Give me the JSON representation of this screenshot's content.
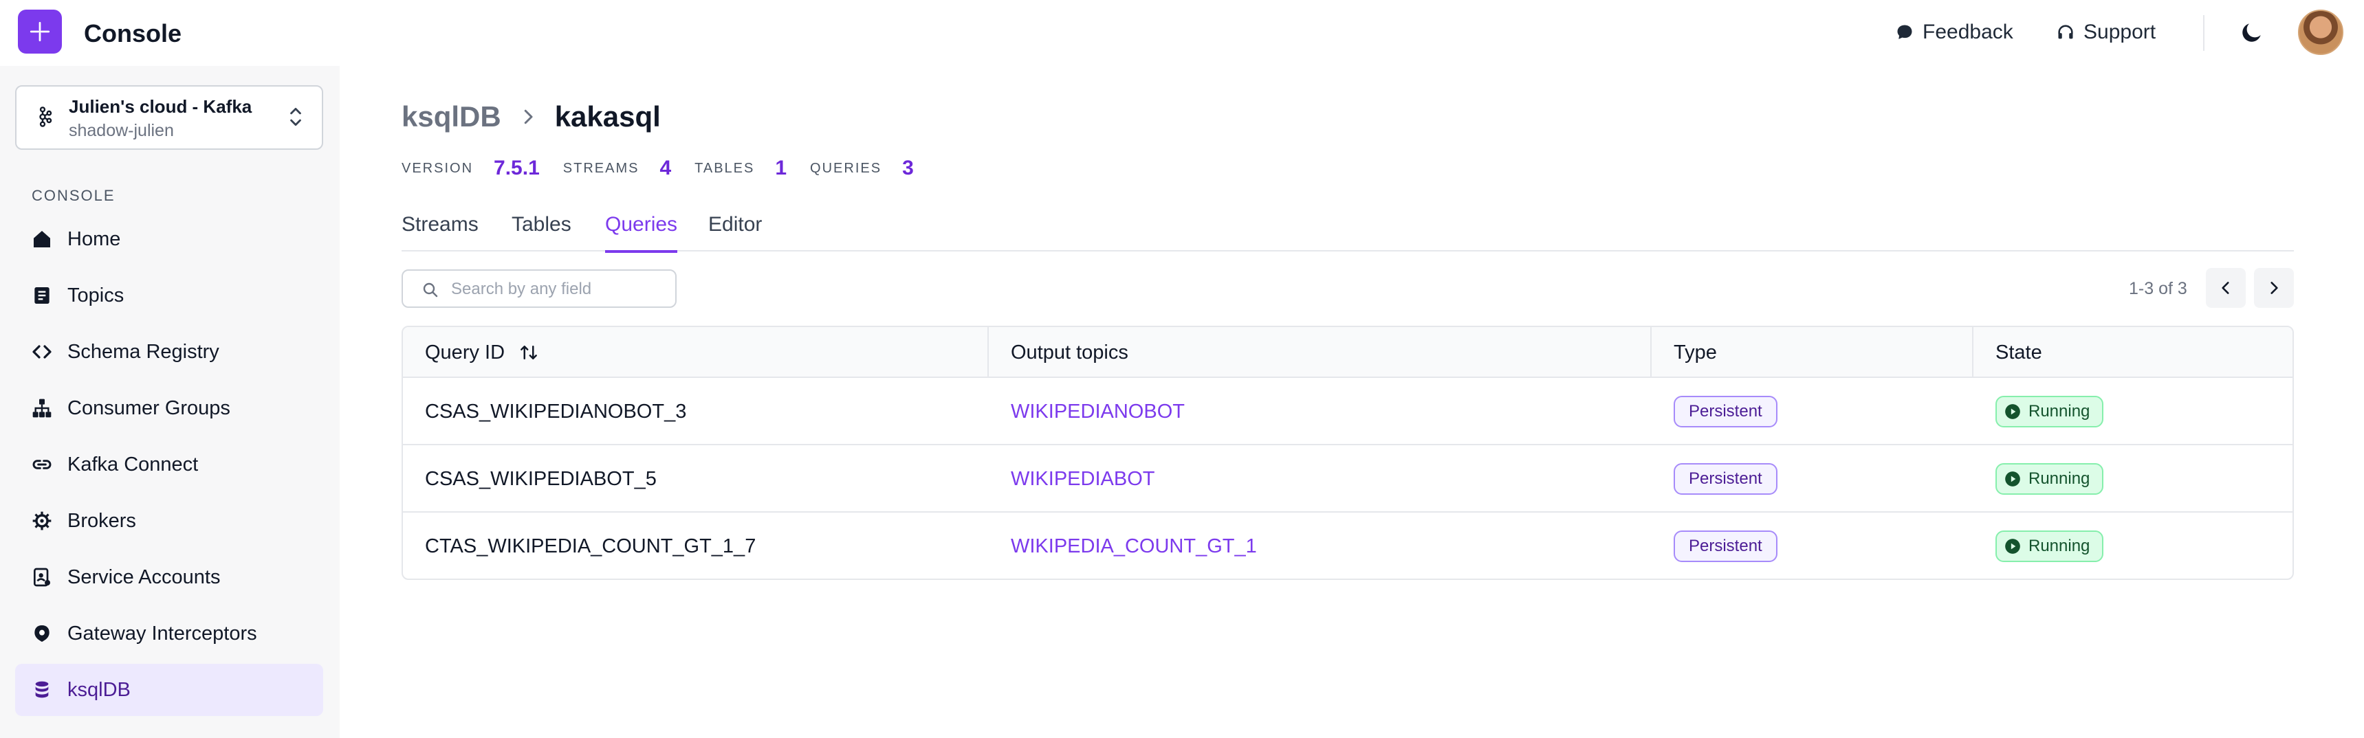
{
  "header": {
    "app_title": "Console",
    "feedback_label": "Feedback",
    "support_label": "Support"
  },
  "cluster": {
    "name": "Julien's cloud - Kafka",
    "subtitle": "shadow-julien"
  },
  "sidebar": {
    "section_label": "CONSOLE",
    "items": [
      {
        "label": "Home",
        "icon": "home-icon"
      },
      {
        "label": "Topics",
        "icon": "topics-icon"
      },
      {
        "label": "Schema Registry",
        "icon": "code-icon"
      },
      {
        "label": "Consumer Groups",
        "icon": "hierarchy-icon"
      },
      {
        "label": "Kafka Connect",
        "icon": "link-icon"
      },
      {
        "label": "Brokers",
        "icon": "cog-icon"
      },
      {
        "label": "Service Accounts",
        "icon": "badge-icon"
      },
      {
        "label": "Gateway Interceptors",
        "icon": "shield-icon"
      },
      {
        "label": "ksqlDB",
        "icon": "database-icon",
        "active": true
      }
    ]
  },
  "breadcrumb": {
    "parent": "ksqlDB",
    "current": "kakasql"
  },
  "stats": {
    "version_label": "VERSION",
    "version_value": "7.5.1",
    "streams_label": "STREAMS",
    "streams_value": "4",
    "tables_label": "TABLES",
    "tables_value": "1",
    "queries_label": "QUERIES",
    "queries_value": "3"
  },
  "tabs": [
    {
      "label": "Streams"
    },
    {
      "label": "Tables"
    },
    {
      "label": "Queries",
      "active": true
    },
    {
      "label": "Editor"
    }
  ],
  "search": {
    "placeholder": "Search by any field"
  },
  "pager": {
    "text": "1-3 of 3"
  },
  "table": {
    "columns": [
      "Query ID",
      "Output topics",
      "Type",
      "State"
    ],
    "rows": [
      {
        "id": "CSAS_WIKIPEDIANOBOT_3",
        "topic": "WIKIPEDIANOBOT",
        "type": "Persistent",
        "state": "Running"
      },
      {
        "id": "CSAS_WIKIPEDIABOT_5",
        "topic": "WIKIPEDIABOT",
        "type": "Persistent",
        "state": "Running"
      },
      {
        "id": "CTAS_WIKIPEDIA_COUNT_GT_1_7",
        "topic": "WIKIPEDIA_COUNT_GT_1",
        "type": "Persistent",
        "state": "Running"
      }
    ]
  },
  "colors": {
    "accent": "#7c3aed",
    "running_bg": "#dcfce7",
    "persistent_border": "#a78bfa"
  }
}
